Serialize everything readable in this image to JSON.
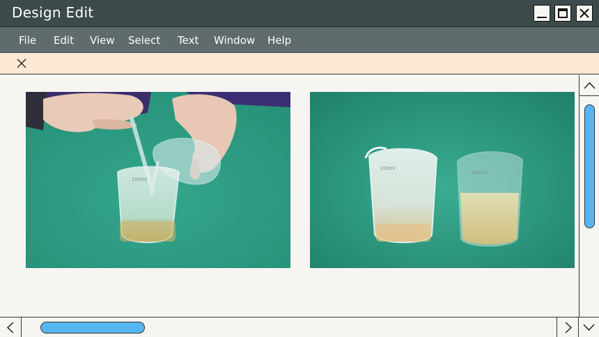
{
  "window": {
    "title": "Design Edit"
  },
  "menu": {
    "items": [
      {
        "label": "File"
      },
      {
        "label": "Edit"
      },
      {
        "label": "View"
      },
      {
        "label": "Select"
      },
      {
        "label": "Text"
      },
      {
        "label": "Window"
      },
      {
        "label": "Help"
      }
    ]
  },
  "infobar": {
    "close_icon": "close-icon"
  },
  "canvas": {
    "images": [
      {
        "name": "image-pouring-beaker",
        "icon": "photo"
      },
      {
        "name": "image-two-beakers",
        "icon": "photo"
      }
    ],
    "beaker_marking": "100ml"
  },
  "scrollbars": {
    "vertical": {
      "position": 0.0
    },
    "horizontal": {
      "position": 0.0
    }
  },
  "colors": {
    "titlebar": "#3d4a4b",
    "menubar": "#5f6b6c",
    "infobar": "#fde9d3",
    "scroll_thumb": "#56b6f2",
    "photo_background": "#2a9a80"
  }
}
